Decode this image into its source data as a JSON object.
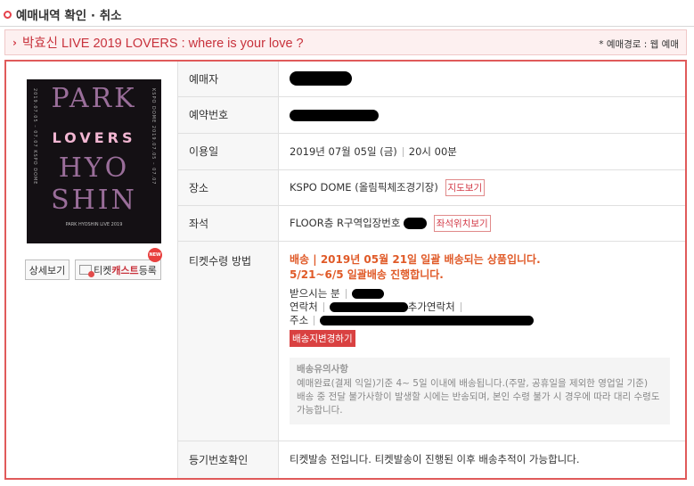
{
  "section_title": "예매내역 확인 · 취소",
  "title_bar": {
    "arrow": "›",
    "performance_title": "박효신 LIVE 2019 LOVERS : where is your love ?",
    "route": "* 예매경로 : 웹 예매"
  },
  "poster": {
    "big_top": "PARK",
    "lovers": "LOVERS",
    "big_mid": "HYO",
    "big_bottom": "SHIN",
    "sub": "PARK HYOSHIN LIVE 2019"
  },
  "buttons": {
    "detail": "상세보기",
    "cast_prefix": "티켓",
    "cast_mid": "캐스트",
    "cast_suffix": "등록",
    "new_badge": "NEW"
  },
  "rows": {
    "booker_label": "예매자",
    "booking_no_label": "예약번호",
    "date_label": "이용일",
    "date_value": "2019년 07월 05일 (금)",
    "time_value": "20시 00분",
    "venue_label": "장소",
    "venue_value": "KSPO DOME (올림픽체조경기장)",
    "map_button": "지도보기",
    "seat_label": "좌석",
    "seat_value": "FLOOR층 R구역입장번호",
    "seat_button": "좌석위치보기",
    "receipt_label": "티켓수령 방법",
    "delivery_line1": "배송 | 2019년 05월 21일 일괄 배송되는 상품입니다.",
    "delivery_line2": "5/21~6/5 일괄배송 진행합니다.",
    "recipient_label": "받으시는 분",
    "contact_label": "연락처",
    "extra_contact_label": "추가연락처",
    "address_label": "주소",
    "address_change_button": "배송지변경하기",
    "notice_title": "배송유의사항",
    "notice_text1": "예매완료(결제 익일)기준 4~ 5일 이내에 배송됩니다.(주말, 공휴일을 제외한 영업일 기준)",
    "notice_text2": "배송 중 전달 불가사항이 발생할 시에는 반송되며, 본인 수령 불가 시 경우에 따라 대리 수령도 가능합니다.",
    "registered_label": "등기번호확인",
    "registered_value": "티켓발송 전입니다. 티켓발송이 진행된 이후 배송추적이 가능합니다."
  }
}
